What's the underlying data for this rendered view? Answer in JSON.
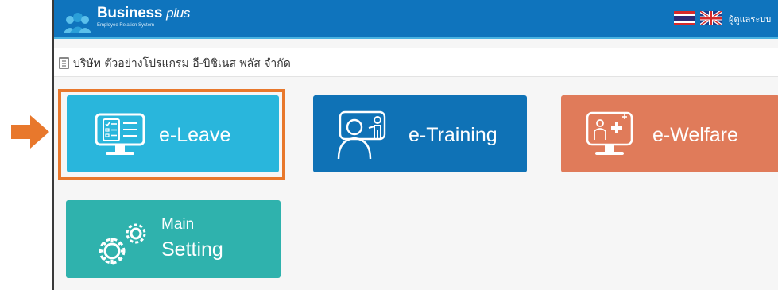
{
  "header": {
    "brand_name": "Business",
    "brand_suffix": "plus",
    "tagline": "Employee Relation System",
    "user_label": "ผู้ดูแลระบบ"
  },
  "company": {
    "name": "บริษัท ตัวอย่างโปรแกรม อี-บิซิเนส พลัส จำกัด"
  },
  "modules": [
    {
      "label": "e-Leave",
      "color": "#29b6dc",
      "icon": "monitor-checklist-icon"
    },
    {
      "label": "e-Training",
      "color": "#0f72b6",
      "icon": "trainer-board-icon"
    },
    {
      "label": "e-Welfare",
      "color": "#e07b5a",
      "icon": "monitor-health-icon"
    },
    {
      "label_line1": "Main",
      "label_line2": "Setting",
      "color": "#2fb2ad",
      "icon": "gears-icon"
    }
  ],
  "annotation": {
    "highlight_color": "#e8782c",
    "arrow_color": "#e8782c",
    "target": "e-Leave"
  }
}
